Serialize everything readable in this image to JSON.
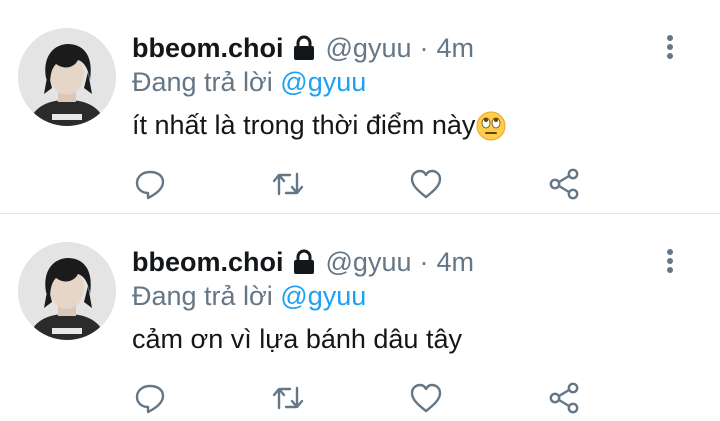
{
  "tweets": [
    {
      "display_name": "bbeom.choi",
      "handle": "@gyuu",
      "separator": "·",
      "time": "4m",
      "reply_prefix": "Đang trả lời",
      "reply_to": "@gyuu",
      "text": "ít nhất là trong thời điểm này",
      "emoji": "face-with-rolling-eyes",
      "protected": true
    },
    {
      "display_name": "bbeom.choi",
      "handle": "@gyuu",
      "separator": "·",
      "time": "4m",
      "reply_prefix": "Đang trả lời",
      "reply_to": "@gyuu",
      "text": "cảm ơn vì lựa bánh dâu tây",
      "protected": true
    }
  ],
  "actions": [
    "reply-icon",
    "retweet-icon",
    "like-icon",
    "share-icon"
  ],
  "colors": {
    "text": "#14171a",
    "muted": "#657786",
    "link": "#1da1f2",
    "divider": "#e1e8ed"
  }
}
